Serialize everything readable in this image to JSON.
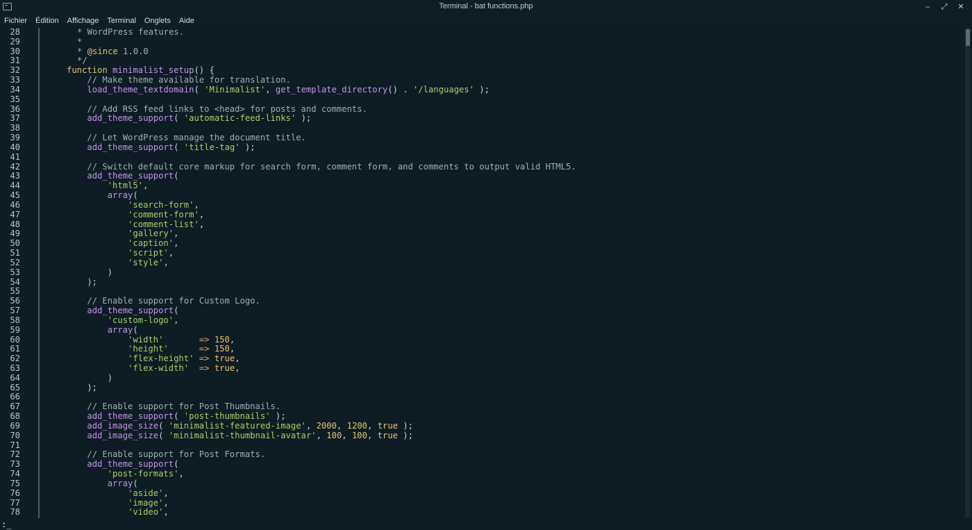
{
  "window": {
    "title": "Terminal - bat functions.php",
    "controls": [
      "–",
      "⤢",
      "✕"
    ]
  },
  "menu": [
    "Fichier",
    "Édition",
    "Affichage",
    "Terminal",
    "Onglets",
    "Aide"
  ],
  "lines": [
    {
      "n": "28",
      "t": [
        [
          "c",
          " * WordPress features."
        ]
      ]
    },
    {
      "n": "29",
      "t": [
        [
          "c",
          " *"
        ]
      ]
    },
    {
      "n": "30",
      "t": [
        [
          "c",
          " * "
        ],
        [
          "k",
          "@since"
        ],
        [
          "c",
          " 1.0.0"
        ]
      ]
    },
    {
      "n": "31",
      "t": [
        [
          "c",
          " */"
        ]
      ]
    },
    {
      "n": "32",
      "t": [
        [
          "k",
          "function"
        ],
        [
          "p",
          " "
        ],
        [
          "f",
          "minimalist_setup"
        ],
        [
          "p",
          "() {"
        ]
      ]
    },
    {
      "n": "33",
      "t": [
        [
          "p",
          "    "
        ],
        [
          "c",
          "// Make theme available for translation."
        ]
      ]
    },
    {
      "n": "34",
      "t": [
        [
          "p",
          "    "
        ],
        [
          "f",
          "load_theme_textdomain"
        ],
        [
          "p",
          "( "
        ],
        [
          "s",
          "'Minimalist'"
        ],
        [
          "p",
          ", "
        ],
        [
          "f",
          "get_template_directory"
        ],
        [
          "p",
          "() . "
        ],
        [
          "s",
          "'/languages'"
        ],
        [
          "p",
          " );"
        ]
      ]
    },
    {
      "n": "35",
      "t": []
    },
    {
      "n": "36",
      "t": [
        [
          "p",
          "    "
        ],
        [
          "c",
          "// Add RSS feed links to <head> for posts and comments."
        ]
      ]
    },
    {
      "n": "37",
      "t": [
        [
          "p",
          "    "
        ],
        [
          "f",
          "add_theme_support"
        ],
        [
          "p",
          "( "
        ],
        [
          "s",
          "'automatic-feed-links'"
        ],
        [
          "p",
          " );"
        ]
      ]
    },
    {
      "n": "38",
      "t": []
    },
    {
      "n": "39",
      "t": [
        [
          "p",
          "    "
        ],
        [
          "c",
          "// Let WordPress manage the document title."
        ]
      ]
    },
    {
      "n": "40",
      "t": [
        [
          "p",
          "    "
        ],
        [
          "f",
          "add_theme_support"
        ],
        [
          "p",
          "( "
        ],
        [
          "s",
          "'title-tag'"
        ],
        [
          "p",
          " );"
        ]
      ]
    },
    {
      "n": "41",
      "t": []
    },
    {
      "n": "42",
      "t": [
        [
          "p",
          "    "
        ],
        [
          "c",
          "// Switch default core markup for search form, comment form, and comments to output valid HTML5."
        ]
      ]
    },
    {
      "n": "43",
      "t": [
        [
          "p",
          "    "
        ],
        [
          "f",
          "add_theme_support"
        ],
        [
          "p",
          "("
        ]
      ]
    },
    {
      "n": "44",
      "t": [
        [
          "p",
          "        "
        ],
        [
          "s",
          "'html5'"
        ],
        [
          "p",
          ","
        ]
      ]
    },
    {
      "n": "45",
      "t": [
        [
          "p",
          "        "
        ],
        [
          "f",
          "array"
        ],
        [
          "p",
          "("
        ]
      ]
    },
    {
      "n": "46",
      "t": [
        [
          "p",
          "            "
        ],
        [
          "s",
          "'search-form'"
        ],
        [
          "p",
          ","
        ]
      ]
    },
    {
      "n": "47",
      "t": [
        [
          "p",
          "            "
        ],
        [
          "s",
          "'comment-form'"
        ],
        [
          "p",
          ","
        ]
      ]
    },
    {
      "n": "48",
      "t": [
        [
          "p",
          "            "
        ],
        [
          "s",
          "'comment-list'"
        ],
        [
          "p",
          ","
        ]
      ]
    },
    {
      "n": "49",
      "t": [
        [
          "p",
          "            "
        ],
        [
          "s",
          "'gallery'"
        ],
        [
          "p",
          ","
        ]
      ]
    },
    {
      "n": "50",
      "t": [
        [
          "p",
          "            "
        ],
        [
          "s",
          "'caption'"
        ],
        [
          "p",
          ","
        ]
      ]
    },
    {
      "n": "51",
      "t": [
        [
          "p",
          "            "
        ],
        [
          "s",
          "'script'"
        ],
        [
          "p",
          ","
        ]
      ]
    },
    {
      "n": "52",
      "t": [
        [
          "p",
          "            "
        ],
        [
          "s",
          "'style'"
        ],
        [
          "p",
          ","
        ]
      ]
    },
    {
      "n": "53",
      "t": [
        [
          "p",
          "        )"
        ]
      ]
    },
    {
      "n": "54",
      "t": [
        [
          "p",
          "    );"
        ]
      ]
    },
    {
      "n": "55",
      "t": []
    },
    {
      "n": "56",
      "t": [
        [
          "p",
          "    "
        ],
        [
          "c",
          "// Enable support for Custom Logo."
        ]
      ]
    },
    {
      "n": "57",
      "t": [
        [
          "p",
          "    "
        ],
        [
          "f",
          "add_theme_support"
        ],
        [
          "p",
          "("
        ]
      ]
    },
    {
      "n": "58",
      "t": [
        [
          "p",
          "        "
        ],
        [
          "s",
          "'custom-logo'"
        ],
        [
          "p",
          ","
        ]
      ]
    },
    {
      "n": "59",
      "t": [
        [
          "p",
          "        "
        ],
        [
          "f",
          "array"
        ],
        [
          "p",
          "("
        ]
      ]
    },
    {
      "n": "60",
      "t": [
        [
          "p",
          "            "
        ],
        [
          "s",
          "'width'"
        ],
        [
          "p",
          "       "
        ],
        [
          "o",
          "=>"
        ],
        [
          "p",
          " "
        ],
        [
          "m",
          "150"
        ],
        [
          "p",
          ","
        ]
      ]
    },
    {
      "n": "61",
      "t": [
        [
          "p",
          "            "
        ],
        [
          "s",
          "'height'"
        ],
        [
          "p",
          "      "
        ],
        [
          "o",
          "=>"
        ],
        [
          "p",
          " "
        ],
        [
          "m",
          "150"
        ],
        [
          "p",
          ","
        ]
      ]
    },
    {
      "n": "62",
      "t": [
        [
          "p",
          "            "
        ],
        [
          "s",
          "'flex-height'"
        ],
        [
          "p",
          " "
        ],
        [
          "o",
          "=>"
        ],
        [
          "p",
          " "
        ],
        [
          "m",
          "true"
        ],
        [
          "p",
          ","
        ]
      ]
    },
    {
      "n": "63",
      "t": [
        [
          "p",
          "            "
        ],
        [
          "s",
          "'flex-width'"
        ],
        [
          "p",
          "  "
        ],
        [
          "o",
          "=>"
        ],
        [
          "p",
          " "
        ],
        [
          "m",
          "true"
        ],
        [
          "p",
          ","
        ]
      ]
    },
    {
      "n": "64",
      "t": [
        [
          "p",
          "        )"
        ]
      ]
    },
    {
      "n": "65",
      "t": [
        [
          "p",
          "    );"
        ]
      ]
    },
    {
      "n": "66",
      "t": []
    },
    {
      "n": "67",
      "t": [
        [
          "p",
          "    "
        ],
        [
          "c",
          "// Enable support for Post Thumbnails."
        ]
      ]
    },
    {
      "n": "68",
      "t": [
        [
          "p",
          "    "
        ],
        [
          "f",
          "add_theme_support"
        ],
        [
          "p",
          "( "
        ],
        [
          "s",
          "'post-thumbnails'"
        ],
        [
          "p",
          " );"
        ]
      ]
    },
    {
      "n": "69",
      "t": [
        [
          "p",
          "    "
        ],
        [
          "f",
          "add_image_size"
        ],
        [
          "p",
          "( "
        ],
        [
          "s",
          "'minimalist-featured-image'"
        ],
        [
          "p",
          ", "
        ],
        [
          "m",
          "2000"
        ],
        [
          "p",
          ", "
        ],
        [
          "m",
          "1200"
        ],
        [
          "p",
          ", "
        ],
        [
          "m",
          "true"
        ],
        [
          "p",
          " );"
        ]
      ]
    },
    {
      "n": "70",
      "t": [
        [
          "p",
          "    "
        ],
        [
          "f",
          "add_image_size"
        ],
        [
          "p",
          "( "
        ],
        [
          "s",
          "'minimalist-thumbnail-avatar'"
        ],
        [
          "p",
          ", "
        ],
        [
          "m",
          "100"
        ],
        [
          "p",
          ", "
        ],
        [
          "m",
          "100"
        ],
        [
          "p",
          ", "
        ],
        [
          "m",
          "true"
        ],
        [
          "p",
          " );"
        ]
      ]
    },
    {
      "n": "71",
      "t": []
    },
    {
      "n": "72",
      "t": [
        [
          "p",
          "    "
        ],
        [
          "c",
          "// Enable support for Post Formats."
        ]
      ]
    },
    {
      "n": "73",
      "t": [
        [
          "p",
          "    "
        ],
        [
          "f",
          "add_theme_support"
        ],
        [
          "p",
          "("
        ]
      ]
    },
    {
      "n": "74",
      "t": [
        [
          "p",
          "        "
        ],
        [
          "s",
          "'post-formats'"
        ],
        [
          "p",
          ","
        ]
      ]
    },
    {
      "n": "75",
      "t": [
        [
          "p",
          "        "
        ],
        [
          "f",
          "array"
        ],
        [
          "p",
          "("
        ]
      ]
    },
    {
      "n": "76",
      "t": [
        [
          "p",
          "            "
        ],
        [
          "s",
          "'aside'"
        ],
        [
          "p",
          ","
        ]
      ]
    },
    {
      "n": "77",
      "t": [
        [
          "p",
          "            "
        ],
        [
          "s",
          "'image'"
        ],
        [
          "p",
          ","
        ]
      ]
    },
    {
      "n": "78",
      "t": [
        [
          "p",
          "            "
        ],
        [
          "s",
          "'video'"
        ],
        [
          "p",
          ","
        ]
      ]
    }
  ],
  "prompt": ":_"
}
